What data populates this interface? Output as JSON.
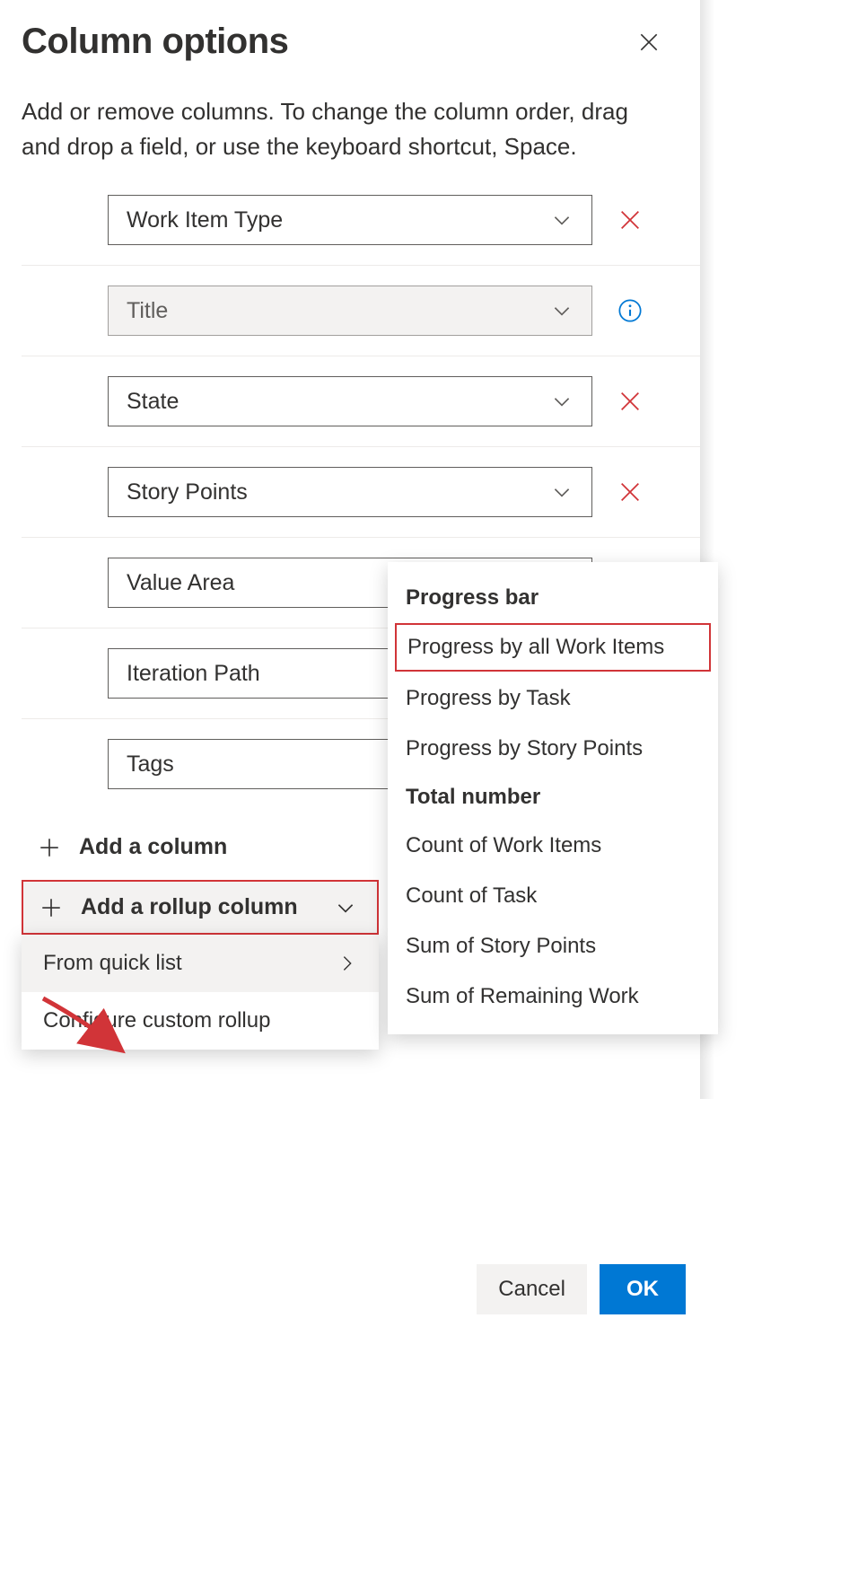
{
  "panel": {
    "title": "Column options",
    "description": "Add or remove columns. To change the column order, drag and drop a field, or use the keyboard shortcut, Space."
  },
  "columns": [
    {
      "label": "Work Item Type",
      "action": "remove"
    },
    {
      "label": "Title",
      "action": "info",
      "disabled": true
    },
    {
      "label": "State",
      "action": "remove"
    },
    {
      "label": "Story Points",
      "action": "remove"
    },
    {
      "label": "Value Area",
      "action": "none"
    },
    {
      "label": "Iteration Path",
      "action": "none"
    },
    {
      "label": "Tags",
      "action": "none"
    }
  ],
  "buttons": {
    "add_column": "Add a column",
    "add_rollup": "Add a rollup column"
  },
  "rollup_dropdown": {
    "from_quick_list": "From quick list",
    "configure_custom": "Configure custom rollup"
  },
  "quicklist": {
    "header1": "Progress bar",
    "items1": [
      "Progress by all Work Items",
      "Progress by Task",
      "Progress by Story Points"
    ],
    "header2": "Total number",
    "items2": [
      "Count of Work Items",
      "Count of Task",
      "Sum of Story Points",
      "Sum of Remaining Work"
    ],
    "highlighted": "Progress by all Work Items"
  },
  "footer": {
    "cancel": "Cancel",
    "ok": "OK"
  }
}
